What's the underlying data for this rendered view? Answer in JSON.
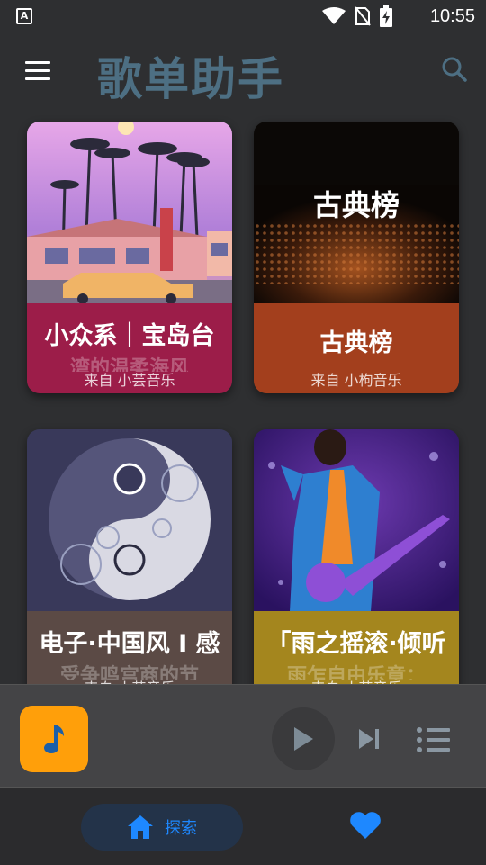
{
  "status_bar": {
    "time": "10:55",
    "left_icon": "A"
  },
  "app_bar": {
    "title": "歌单助手",
    "menu_icon": "hamburger-icon",
    "search_icon": "search-icon"
  },
  "playlists": [
    {
      "title": "小众系｜宝岛台",
      "ghost": "湾的温柔海风",
      "source": "来自 小芸音乐",
      "caption_color": "#9c1d49"
    },
    {
      "title": "古典榜",
      "cover_text": "古典榜",
      "source": "来自 小枸音乐",
      "caption_color": "#a33f1d"
    },
    {
      "title": "电子·中国风 I 感",
      "ghost": "受争鸣宫商的节",
      "source": "来自 小芸音乐",
      "caption_color": "#5b4a45"
    },
    {
      "title": "「雨之摇滚·倾听",
      "ghost": "雨乍自由乐章：",
      "source": "来自 小芸音乐",
      "caption_color": "#a4861e"
    }
  ],
  "player": {
    "art_icon": "music-note-icon",
    "play_icon": "play-icon",
    "next_icon": "skip-next-icon",
    "list_icon": "playlist-icon",
    "accent": "#ff9f0a"
  },
  "bottom_nav": {
    "explore_label": "探索",
    "explore_icon": "home-icon",
    "favorite_icon": "heart-icon",
    "accent": "#1e88ff"
  }
}
